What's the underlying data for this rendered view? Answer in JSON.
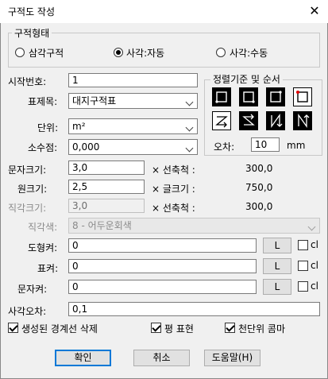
{
  "window": {
    "title": "구적도 작성",
    "close_glyph": "✕"
  },
  "shape_group": {
    "label": "구적형태",
    "options": [
      "삼각구적",
      "사각:자동",
      "사각:수동"
    ],
    "selected": "사각:자동"
  },
  "fields": {
    "start_no_label": "시작번호:",
    "start_no": "1",
    "title_label": "표제목:",
    "title": "대지구적표",
    "unit_label": "단위:",
    "unit": "m²",
    "decimal_label": "소수점:",
    "decimal": "0,000",
    "text_size_label": "문자크기:",
    "text_size": "3,0",
    "circle_size_label": "원크기:",
    "circle_size": "2,5",
    "square_size_label": "직각크기:",
    "square_size": "3,0",
    "square_color_label": "직각색:",
    "square_color": "8 - 어두운회색"
  },
  "scale_notes": {
    "text": {
      "label": "× 선축척 :",
      "value": "300,0"
    },
    "circle": {
      "label": "× 글크기 :",
      "value": "750,0"
    },
    "square": {
      "label": "× 선축척 :",
      "value": "300,0"
    }
  },
  "sort_group": {
    "label": "정렬기준 및 순서",
    "tolerance_label": "오차:",
    "tolerance": "10",
    "tolerance_unit": "mm"
  },
  "layers": {
    "shape_label": "도형켜:",
    "shape": "0",
    "table_label": "표켜:",
    "table": "0",
    "text_label": "문자켜:",
    "text": "0",
    "l_button": "L",
    "cl_label": "cl"
  },
  "square_error": {
    "label": "사각오차:",
    "value": "0,1"
  },
  "checks": [
    {
      "label": "생성된 경계선 삭제",
      "checked": true
    },
    {
      "label": "평 표현",
      "checked": true
    },
    {
      "label": "천단위 콤마",
      "checked": true
    }
  ],
  "buttons": {
    "ok": "확인",
    "cancel": "취소",
    "help": "도움말(H)"
  }
}
